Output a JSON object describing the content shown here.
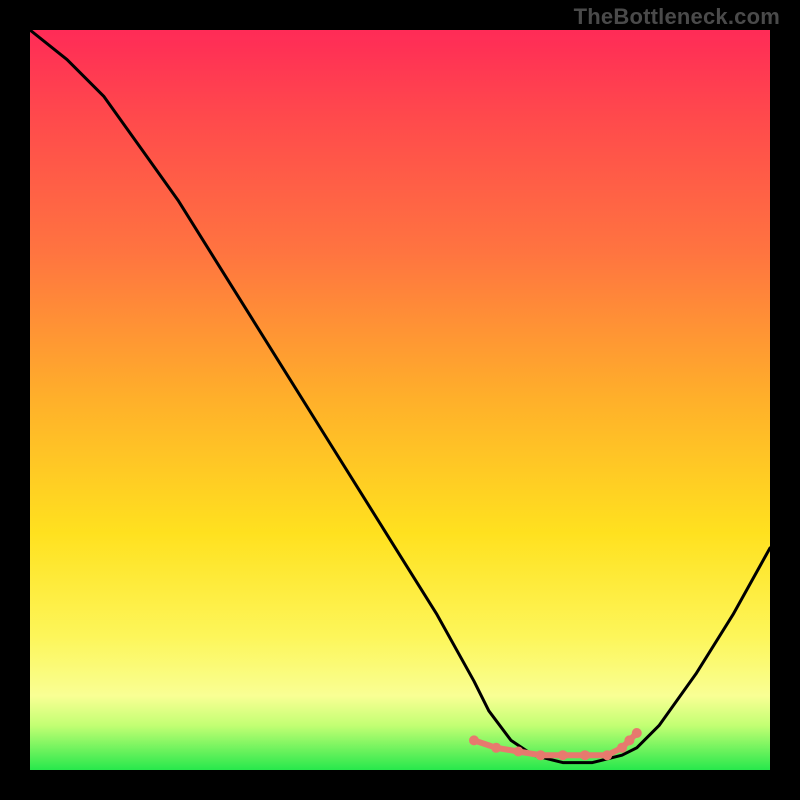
{
  "watermark": "TheBottleneck.com",
  "colors": {
    "background": "#000000",
    "curve": "#000000",
    "marker": "#e77a6e",
    "gradient_stops": [
      "#ff2b57",
      "#ff4a4c",
      "#ff7440",
      "#ffb02a",
      "#ffe11f",
      "#fdf65a",
      "#f9ff94",
      "#c2ff73",
      "#27e84c"
    ]
  },
  "chart_data": {
    "type": "line",
    "title": "",
    "xlabel": "",
    "ylabel": "",
    "xlim": [
      0,
      100
    ],
    "ylim": [
      0,
      100
    ],
    "grid": false,
    "legend": null,
    "series": [
      {
        "name": "curve",
        "x": [
          0,
          5,
          10,
          15,
          20,
          25,
          30,
          35,
          40,
          45,
          50,
          55,
          60,
          62,
          65,
          68,
          72,
          76,
          80,
          82,
          85,
          90,
          95,
          100
        ],
        "values": [
          100,
          96,
          91,
          84,
          77,
          69,
          61,
          53,
          45,
          37,
          29,
          21,
          12,
          8,
          4,
          2,
          1,
          1,
          2,
          3,
          6,
          13,
          21,
          30
        ]
      }
    ],
    "markers": {
      "name": "bottom-cluster",
      "x": [
        60,
        63,
        66,
        69,
        72,
        75,
        78,
        80,
        81,
        82
      ],
      "values": [
        4,
        3,
        2.5,
        2,
        2,
        2,
        2,
        3,
        4,
        5
      ]
    }
  }
}
